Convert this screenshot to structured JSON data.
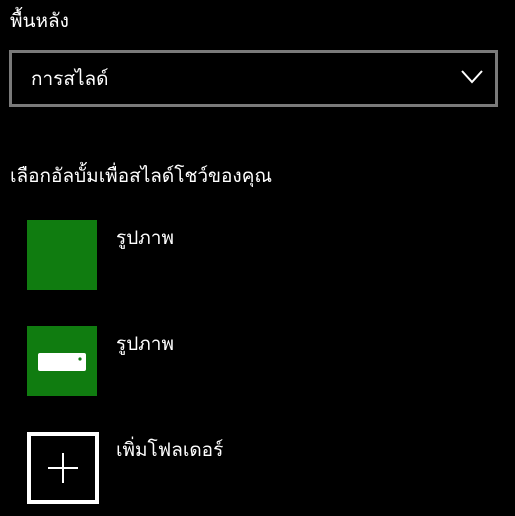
{
  "background_section": {
    "label": "พื้นหลัง",
    "dropdown_value": "การสไลด์",
    "dropdown_icon": "chevron-down-icon"
  },
  "albums_section": {
    "heading": "เลือกอัลบั้มเพื่อสไลด์โชว์ของคุณ",
    "items": [
      {
        "label": "รูปภาพ",
        "icon": "folder-thumbnail",
        "thumb_color": "#107c10"
      },
      {
        "label": "รูปภาพ",
        "icon": "drive-icon",
        "thumb_color": "#107c10"
      }
    ],
    "add_folder": {
      "label": "เพิ่มโฟลเดอร์",
      "icon": "plus-icon"
    }
  },
  "colors": {
    "background": "#000000",
    "accent": "#107c10",
    "dropdown_border": "#7a7a7a",
    "text": "#ffffff"
  }
}
